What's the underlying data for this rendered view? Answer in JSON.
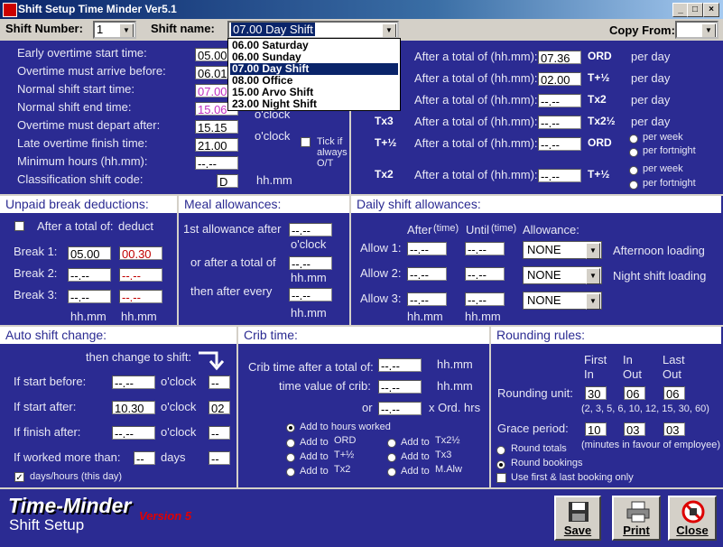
{
  "window": {
    "title": "Shift Setup Time Minder Ver5.1",
    "controls": [
      "_",
      "□",
      "×"
    ]
  },
  "top": {
    "shift_number_label": "Shift Number:",
    "shift_number_value": "1",
    "shift_name_label": "Shift name:",
    "shift_name_value": "07.00 Day Shift",
    "copy_from_label": "Copy From:",
    "copy_from_value": ""
  },
  "dropdown": {
    "options": [
      "06.00 Saturday",
      "06.00 Sunday",
      "07.00 Day Shift",
      "08.00 Office",
      "15.00 Arvo Shift",
      "23.00 Night Shift"
    ],
    "selected_index": 2
  },
  "shift_times": {
    "rows": [
      {
        "label": "Early overtime start time:",
        "value": "05.00",
        "suffix": ""
      },
      {
        "label": "Overtime must arrive before:",
        "value": "06.01",
        "suffix": ""
      },
      {
        "label": "Normal shift start time:",
        "value": "07.00",
        "suffix": ""
      },
      {
        "label": "Normal shift end time:",
        "value": "15.06",
        "suffix": ""
      },
      {
        "label": "Overtime must depart after:",
        "value": "15.15",
        "suffix": "o'clock"
      },
      {
        "label": "Late overtime finish time:",
        "value": "21.00",
        "suffix": "o'clock"
      },
      {
        "label": "Minimum hours (hh.mm):",
        "value": "--.--",
        "suffix": ""
      },
      {
        "label": "Classification shift code:",
        "value": "D",
        "suffix": "hh.mm"
      }
    ],
    "tick_label": "Tick if always O/T"
  },
  "overtime_rates": {
    "rows": [
      {
        "code": "",
        "label": "After a total of (hh.mm):",
        "value": "07.36",
        "rate": "ORD",
        "per": "per day"
      },
      {
        "code": "",
        "label": "After a total of (hh.mm):",
        "value": "02.00",
        "rate": "T+½",
        "per": "per day"
      },
      {
        "code": "",
        "label": "After a total of (hh.mm):",
        "value": "--.--",
        "rate": "Tx2",
        "per": "per day"
      },
      {
        "code": "Tx3",
        "label": "After a total of (hh.mm):",
        "value": "--.--",
        "rate": "Tx2½",
        "per": "per day"
      },
      {
        "code": "T+½",
        "label": "After a total of (hh.mm):",
        "value": "--.--",
        "rate": "ORD",
        "per": ""
      },
      {
        "code": "Tx2",
        "label": "After a total of (hh.mm):",
        "value": "--.--",
        "rate": "T+½",
        "per": ""
      }
    ],
    "per_week": "per week",
    "per_fortnight": "per fortnight"
  },
  "unpaid_break": {
    "title": "Unpaid break deductions:",
    "after_label": "After a total of:",
    "deduct_label": "deduct",
    "breaks": [
      {
        "label": "Break 1:",
        "after": "05.00",
        "deduct": "00.30"
      },
      {
        "label": "Break 2:",
        "after": "--.--",
        "deduct": "--.--"
      },
      {
        "label": "Break 3:",
        "after": "--.--",
        "deduct": "--.--"
      }
    ],
    "unit1": "hh.mm",
    "unit2": "hh.mm"
  },
  "meal": {
    "title": "Meal allowances:",
    "first_label": "1st allowance after",
    "first_value": "--.--",
    "first_unit": "o'clock",
    "total_label": "or after a total of",
    "total_value": "--.--",
    "total_unit": "hh.mm",
    "every_label": "then after every",
    "every_value": "--.--",
    "every_unit": "hh.mm"
  },
  "daily": {
    "title": "Daily shift allowances:",
    "after_head": "After",
    "until_head": "Until",
    "time_note": "(time)",
    "allowance_head": "Allowance:",
    "rows": [
      {
        "label": "Allow 1:",
        "after": "--.--",
        "until": "--.--",
        "allowance": "NONE"
      },
      {
        "label": "Allow 2:",
        "after": "--.--",
        "until": "--.--",
        "allowance": "NONE"
      },
      {
        "label": "Allow 3:",
        "after": "--.--",
        "until": "--.--",
        "allowance": "NONE"
      }
    ],
    "afternoon": "Afternoon loading",
    "night": "Night shift loading",
    "unit1": "hh.mm",
    "unit2": "hh.mm"
  },
  "auto": {
    "title": "Auto shift change:",
    "then_change": "then change to shift:",
    "rows": [
      {
        "label": "If start before:",
        "value": "--.--",
        "unit": "o'clock",
        "shift": "--"
      },
      {
        "label": "If start after:",
        "value": "10.30",
        "unit": "o'clock",
        "shift": "02"
      },
      {
        "label": "If finish after:",
        "value": "--.--",
        "unit": "o'clock",
        "shift": "--"
      },
      {
        "label": "If worked more than:",
        "value": "--",
        "unit": "days",
        "shift": "--"
      }
    ],
    "days_label": "days/hours (this day)"
  },
  "crib": {
    "title": "Crib time:",
    "after_label": "Crib time after a total of:",
    "after_value": "--.--",
    "after_unit": "hh.mm",
    "value_label": "time value of crib:",
    "value_value": "--.--",
    "value_unit": "hh.mm",
    "or_label": "or",
    "or_value": "--.--",
    "or_unit": "x Ord. hrs",
    "add_hours": "Add to hours worked",
    "add_to": "Add to",
    "options_left": [
      "ORD",
      "T+½",
      "Tx2"
    ],
    "options_right": [
      "Tx2½",
      "Tx3",
      "M.Alw"
    ]
  },
  "rounding": {
    "title": "Rounding rules:",
    "first_head": "First",
    "in_head": "In",
    "in_head2": "In",
    "out_head": "Out",
    "last_head": "Last",
    "out_head2": "Out",
    "unit_label": "Rounding unit:",
    "unit_values": [
      "30",
      "06",
      "06"
    ],
    "unit_note": "(2, 3, 5, 6, 10, 12, 15, 30, 60)",
    "grace_label": "Grace period:",
    "grace_values": [
      "10",
      "03",
      "03"
    ],
    "grace_note": "(minutes in favour of employee)",
    "round_totals": "Round totals",
    "round_bookings": "Round bookings",
    "first_last": "Use first & last booking only"
  },
  "footer": {
    "brand": "Time-Minder",
    "subtitle": "Shift Setup",
    "version": "Version 5",
    "save": "Save",
    "print": "Print",
    "close": "Close"
  }
}
